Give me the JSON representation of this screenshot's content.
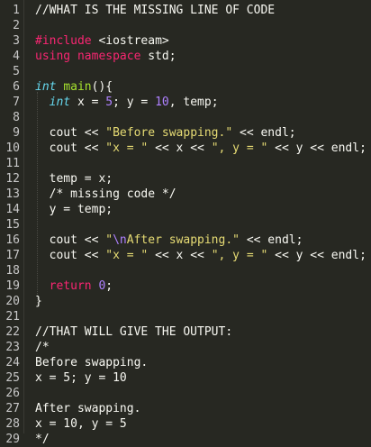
{
  "editor": {
    "background": "#272822",
    "lines": [
      {
        "n": "1",
        "t": [
          [
            "comment",
            "//WHAT IS THE MISSING LINE OF CODE"
          ]
        ]
      },
      {
        "n": "2",
        "t": []
      },
      {
        "n": "3",
        "t": [
          [
            "pp",
            "#include "
          ],
          [
            "ppv",
            "<iostream>"
          ]
        ]
      },
      {
        "n": "4",
        "t": [
          [
            "kw",
            "using namespace "
          ],
          [
            "plain",
            "std;"
          ]
        ]
      },
      {
        "n": "5",
        "t": []
      },
      {
        "n": "6",
        "t": [
          [
            "type",
            "int "
          ],
          [
            "fn",
            "main"
          ],
          [
            "plain",
            "(){"
          ]
        ]
      },
      {
        "n": "7",
        "t": [
          [
            "plain",
            "  "
          ],
          [
            "type",
            "int "
          ],
          [
            "plain",
            "x = "
          ],
          [
            "num",
            "5"
          ],
          [
            "plain",
            "; y = "
          ],
          [
            "num",
            "10"
          ],
          [
            "plain",
            ", temp;"
          ]
        ]
      },
      {
        "n": "8",
        "t": []
      },
      {
        "n": "9",
        "t": [
          [
            "plain",
            "  cout << "
          ],
          [
            "str",
            "\"Before swapping.\""
          ],
          [
            "plain",
            " << endl;"
          ]
        ]
      },
      {
        "n": "10",
        "t": [
          [
            "plain",
            "  cout << "
          ],
          [
            "str",
            "\"x = \""
          ],
          [
            "plain",
            " << x << "
          ],
          [
            "str",
            "\", y = \""
          ],
          [
            "plain",
            " << y << endl;"
          ]
        ]
      },
      {
        "n": "11",
        "t": []
      },
      {
        "n": "12",
        "t": [
          [
            "plain",
            "  temp = x;"
          ]
        ]
      },
      {
        "n": "13",
        "t": [
          [
            "plain",
            "  /* missing code */"
          ]
        ]
      },
      {
        "n": "14",
        "t": [
          [
            "plain",
            "  y = temp;"
          ]
        ]
      },
      {
        "n": "15",
        "t": []
      },
      {
        "n": "16",
        "t": [
          [
            "plain",
            "  cout << "
          ],
          [
            "str",
            "\""
          ],
          [
            "esc",
            "\\n"
          ],
          [
            "str",
            "After swapping.\""
          ],
          [
            "plain",
            " << endl;"
          ]
        ]
      },
      {
        "n": "17",
        "t": [
          [
            "plain",
            "  cout << "
          ],
          [
            "str",
            "\"x = \""
          ],
          [
            "plain",
            " << x << "
          ],
          [
            "str",
            "\", y = \""
          ],
          [
            "plain",
            " << y << endl;"
          ]
        ]
      },
      {
        "n": "18",
        "t": []
      },
      {
        "n": "19",
        "t": [
          [
            "plain",
            "  "
          ],
          [
            "kw",
            "return "
          ],
          [
            "num",
            "0"
          ],
          [
            "plain",
            ";"
          ]
        ]
      },
      {
        "n": "20",
        "t": [
          [
            "plain",
            "}"
          ]
        ]
      },
      {
        "n": "21",
        "t": []
      },
      {
        "n": "22",
        "t": [
          [
            "comment",
            "//THAT WILL GIVE THE OUTPUT:"
          ]
        ]
      },
      {
        "n": "23",
        "t": [
          [
            "plain",
            "/*"
          ]
        ]
      },
      {
        "n": "24",
        "t": [
          [
            "plain",
            "Before swapping."
          ]
        ]
      },
      {
        "n": "25",
        "t": [
          [
            "plain",
            "x = 5; y = 10"
          ]
        ]
      },
      {
        "n": "26",
        "t": []
      },
      {
        "n": "27",
        "t": [
          [
            "plain",
            "After swapping."
          ]
        ]
      },
      {
        "n": "28",
        "t": [
          [
            "plain",
            "x = 10, y = 5"
          ]
        ]
      },
      {
        "n": "29",
        "t": [
          [
            "plain",
            "*/"
          ]
        ]
      }
    ]
  }
}
